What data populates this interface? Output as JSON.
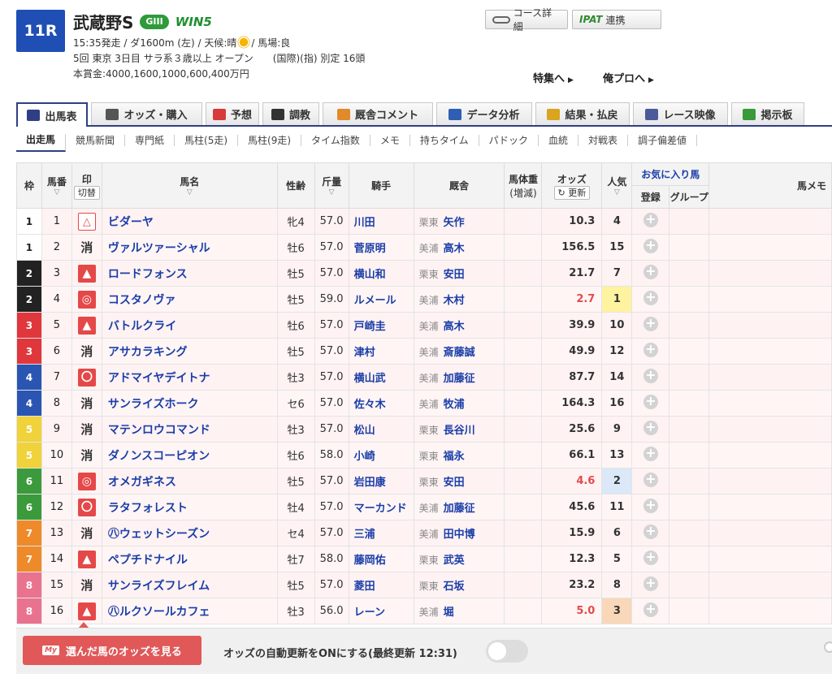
{
  "header": {
    "race_no": "11R",
    "race_name": "武蔵野S",
    "grade": "GIII",
    "win5": "WIN5",
    "line1_a": "15:35発走 / ダ1600m (左) / 天候:晴",
    "line1_b": "/ 馬場:良",
    "line2": "5回 東京 3日目 サラ系３歳以上 オープン　　(国際)(指) 別定 16頭",
    "line3": "本賞金:4000,1600,1000,600,400万円",
    "course_btn": "コース詳細",
    "ipat_logo": "IPAT",
    "ipat_btn": "連携",
    "link_feature": "特集へ",
    "link_pro": "俺プロへ"
  },
  "main_tabs": [
    {
      "label": "出馬表",
      "icon": "entry-table-icon",
      "color": "#2e3f86"
    },
    {
      "label": "オッズ・購入",
      "icon": "odds-icon",
      "color": "#555555"
    },
    {
      "label": "予想",
      "icon": "target-icon",
      "color": "#d63a3a"
    },
    {
      "label": "調教",
      "icon": "stopwatch-icon",
      "color": "#333333"
    },
    {
      "label": "厩舎コメント",
      "icon": "stable-icon",
      "color": "#e08a2a"
    },
    {
      "label": "データ分析",
      "icon": "bar-chart-icon",
      "color": "#2e5fb4"
    },
    {
      "label": "結果・払戻",
      "icon": "coins-icon",
      "color": "#d9a520"
    },
    {
      "label": "レース映像",
      "icon": "video-icon",
      "color": "#4a5a9a"
    },
    {
      "label": "掲示板",
      "icon": "chat-icon",
      "color": "#3a9a3a"
    }
  ],
  "sub_tabs": [
    "出走馬",
    "競馬新聞",
    "専門紙",
    "馬柱(5走)",
    "馬柱(9走)",
    "タイム指数",
    "メモ",
    "持ちタイム",
    "パドック",
    "血統",
    "対戦表",
    "調子偏差値"
  ],
  "table_head": {
    "waku": "枠",
    "umaban": "馬番",
    "mark": "印",
    "mark_btn": "切替",
    "name": "馬名",
    "sex_age": "性齢",
    "kinryo": "斤量",
    "jockey": "騎手",
    "stable": "厩舎",
    "weight": "馬体重",
    "weight_sub": "(増減)",
    "odds": "オッズ",
    "refresh_btn": "更新",
    "pop": "人気",
    "fav": "お気に入り馬",
    "fav_reg": "登録",
    "fav_group": "グループ",
    "memo": "馬メモ"
  },
  "waku_colors": {
    "1": {
      "bg": "#ffffff",
      "fg": "#222222"
    },
    "2": {
      "bg": "#222222",
      "fg": "#ffffff"
    },
    "3": {
      "bg": "#e0373c",
      "fg": "#ffffff"
    },
    "4": {
      "bg": "#2a55b2",
      "fg": "#ffffff"
    },
    "5": {
      "bg": "#f0d23a",
      "fg": "#ffffff"
    },
    "6": {
      "bg": "#3b9a3b",
      "fg": "#ffffff"
    },
    "7": {
      "bg": "#ee8a2a",
      "fg": "#ffffff"
    },
    "8": {
      "bg": "#e9738f",
      "fg": "#ffffff"
    }
  },
  "horses": [
    {
      "waku": "1",
      "num": "1",
      "mark": "△",
      "mark_style": "outline",
      "name": "ビダーヤ",
      "sex_age": "牝4",
      "kinryo": "57.0",
      "jockey": "川田",
      "area": "栗東",
      "trainer": "矢作",
      "odds": "10.3",
      "hot": false,
      "pop": "4",
      "pop_bg": ""
    },
    {
      "waku": "1",
      "num": "2",
      "mark": "消",
      "mark_style": "text",
      "name": "ヴァルツァーシャル",
      "sex_age": "牡6",
      "kinryo": "57.0",
      "jockey": "菅原明",
      "area": "美浦",
      "trainer": "高木",
      "odds": "156.5",
      "hot": false,
      "pop": "15",
      "pop_bg": ""
    },
    {
      "waku": "2",
      "num": "3",
      "mark": "▲",
      "mark_style": "red",
      "name": "ロードフォンス",
      "sex_age": "牡5",
      "kinryo": "57.0",
      "jockey": "横山和",
      "area": "栗東",
      "trainer": "安田",
      "odds": "21.7",
      "hot": false,
      "pop": "7",
      "pop_bg": ""
    },
    {
      "waku": "2",
      "num": "4",
      "mark": "◎",
      "mark_style": "red",
      "name": "コスタノヴァ",
      "sex_age": "牡5",
      "kinryo": "59.0",
      "jockey": "ルメール",
      "area": "美浦",
      "trainer": "木村",
      "odds": "2.7",
      "hot": true,
      "pop": "1",
      "pop_bg": "#fff3a0"
    },
    {
      "waku": "3",
      "num": "5",
      "mark": "▲",
      "mark_style": "red",
      "name": "バトルクライ",
      "sex_age": "牡6",
      "kinryo": "57.0",
      "jockey": "戸崎圭",
      "area": "美浦",
      "trainer": "高木",
      "odds": "39.9",
      "hot": false,
      "pop": "10",
      "pop_bg": ""
    },
    {
      "waku": "3",
      "num": "6",
      "mark": "消",
      "mark_style": "text",
      "name": "アサカラキング",
      "sex_age": "牡5",
      "kinryo": "57.0",
      "jockey": "津村",
      "area": "美浦",
      "trainer": "斎藤誠",
      "odds": "49.9",
      "hot": false,
      "pop": "12",
      "pop_bg": ""
    },
    {
      "waku": "4",
      "num": "7",
      "mark": "〇",
      "mark_style": "red",
      "name": "アドマイヤデイトナ",
      "sex_age": "牡3",
      "kinryo": "57.0",
      "jockey": "横山武",
      "area": "美浦",
      "trainer": "加藤征",
      "odds": "87.7",
      "hot": false,
      "pop": "14",
      "pop_bg": ""
    },
    {
      "waku": "4",
      "num": "8",
      "mark": "消",
      "mark_style": "text",
      "name": "サンライズホーク",
      "sex_age": "セ6",
      "kinryo": "57.0",
      "jockey": "佐々木",
      "area": "美浦",
      "trainer": "牧浦",
      "odds": "164.3",
      "hot": false,
      "pop": "16",
      "pop_bg": ""
    },
    {
      "waku": "5",
      "num": "9",
      "mark": "消",
      "mark_style": "text",
      "name": "マテンロウコマンド",
      "sex_age": "牡3",
      "kinryo": "57.0",
      "jockey": "松山",
      "area": "栗東",
      "trainer": "長谷川",
      "odds": "25.6",
      "hot": false,
      "pop": "9",
      "pop_bg": ""
    },
    {
      "waku": "5",
      "num": "10",
      "mark": "消",
      "mark_style": "text",
      "name": "ダノンスコーピオン",
      "sex_age": "牡6",
      "kinryo": "58.0",
      "jockey": "小崎",
      "area": "栗東",
      "trainer": "福永",
      "odds": "66.1",
      "hot": false,
      "pop": "13",
      "pop_bg": ""
    },
    {
      "waku": "6",
      "num": "11",
      "mark": "◎",
      "mark_style": "red",
      "name": "オメガギネス",
      "sex_age": "牡5",
      "kinryo": "57.0",
      "jockey": "岩田康",
      "area": "栗東",
      "trainer": "安田",
      "odds": "4.6",
      "hot": true,
      "pop": "2",
      "pop_bg": "#dbe8f8"
    },
    {
      "waku": "6",
      "num": "12",
      "mark": "〇",
      "mark_style": "red",
      "name": "ラタフォレスト",
      "sex_age": "牡4",
      "kinryo": "57.0",
      "jockey": "マーカンド",
      "area": "美浦",
      "trainer": "加藤征",
      "odds": "45.6",
      "hot": false,
      "pop": "11",
      "pop_bg": ""
    },
    {
      "waku": "7",
      "num": "13",
      "mark": "消",
      "mark_style": "text",
      "name": "㊇ウェットシーズン",
      "sex_age": "セ4",
      "kinryo": "57.0",
      "jockey": "三浦",
      "area": "美浦",
      "trainer": "田中博",
      "odds": "15.9",
      "hot": false,
      "pop": "6",
      "pop_bg": ""
    },
    {
      "waku": "7",
      "num": "14",
      "mark": "▲",
      "mark_style": "red",
      "name": "ペプチドナイル",
      "sex_age": "牡7",
      "kinryo": "58.0",
      "jockey": "藤岡佑",
      "area": "栗東",
      "trainer": "武英",
      "odds": "12.3",
      "hot": false,
      "pop": "5",
      "pop_bg": ""
    },
    {
      "waku": "8",
      "num": "15",
      "mark": "消",
      "mark_style": "text",
      "name": "サンライズフレイム",
      "sex_age": "牡5",
      "kinryo": "57.0",
      "jockey": "菱田",
      "area": "栗東",
      "trainer": "石坂",
      "odds": "23.2",
      "hot": false,
      "pop": "8",
      "pop_bg": ""
    },
    {
      "waku": "8",
      "num": "16",
      "mark": "▲",
      "mark_style": "red",
      "name": "㊇ルクソールカフェ",
      "sex_age": "牡3",
      "kinryo": "56.0",
      "jockey": "レーン",
      "area": "美浦",
      "trainer": "堀",
      "odds": "5.0",
      "hot": true,
      "pop": "3",
      "pop_bg": "#f8d8b8"
    }
  ],
  "bottom": {
    "my_badge": "My",
    "odds_btn": "選んだ馬のオッズを見る",
    "auto_update": "オッズの自動更新をONにする(最終更新 12:31)"
  }
}
